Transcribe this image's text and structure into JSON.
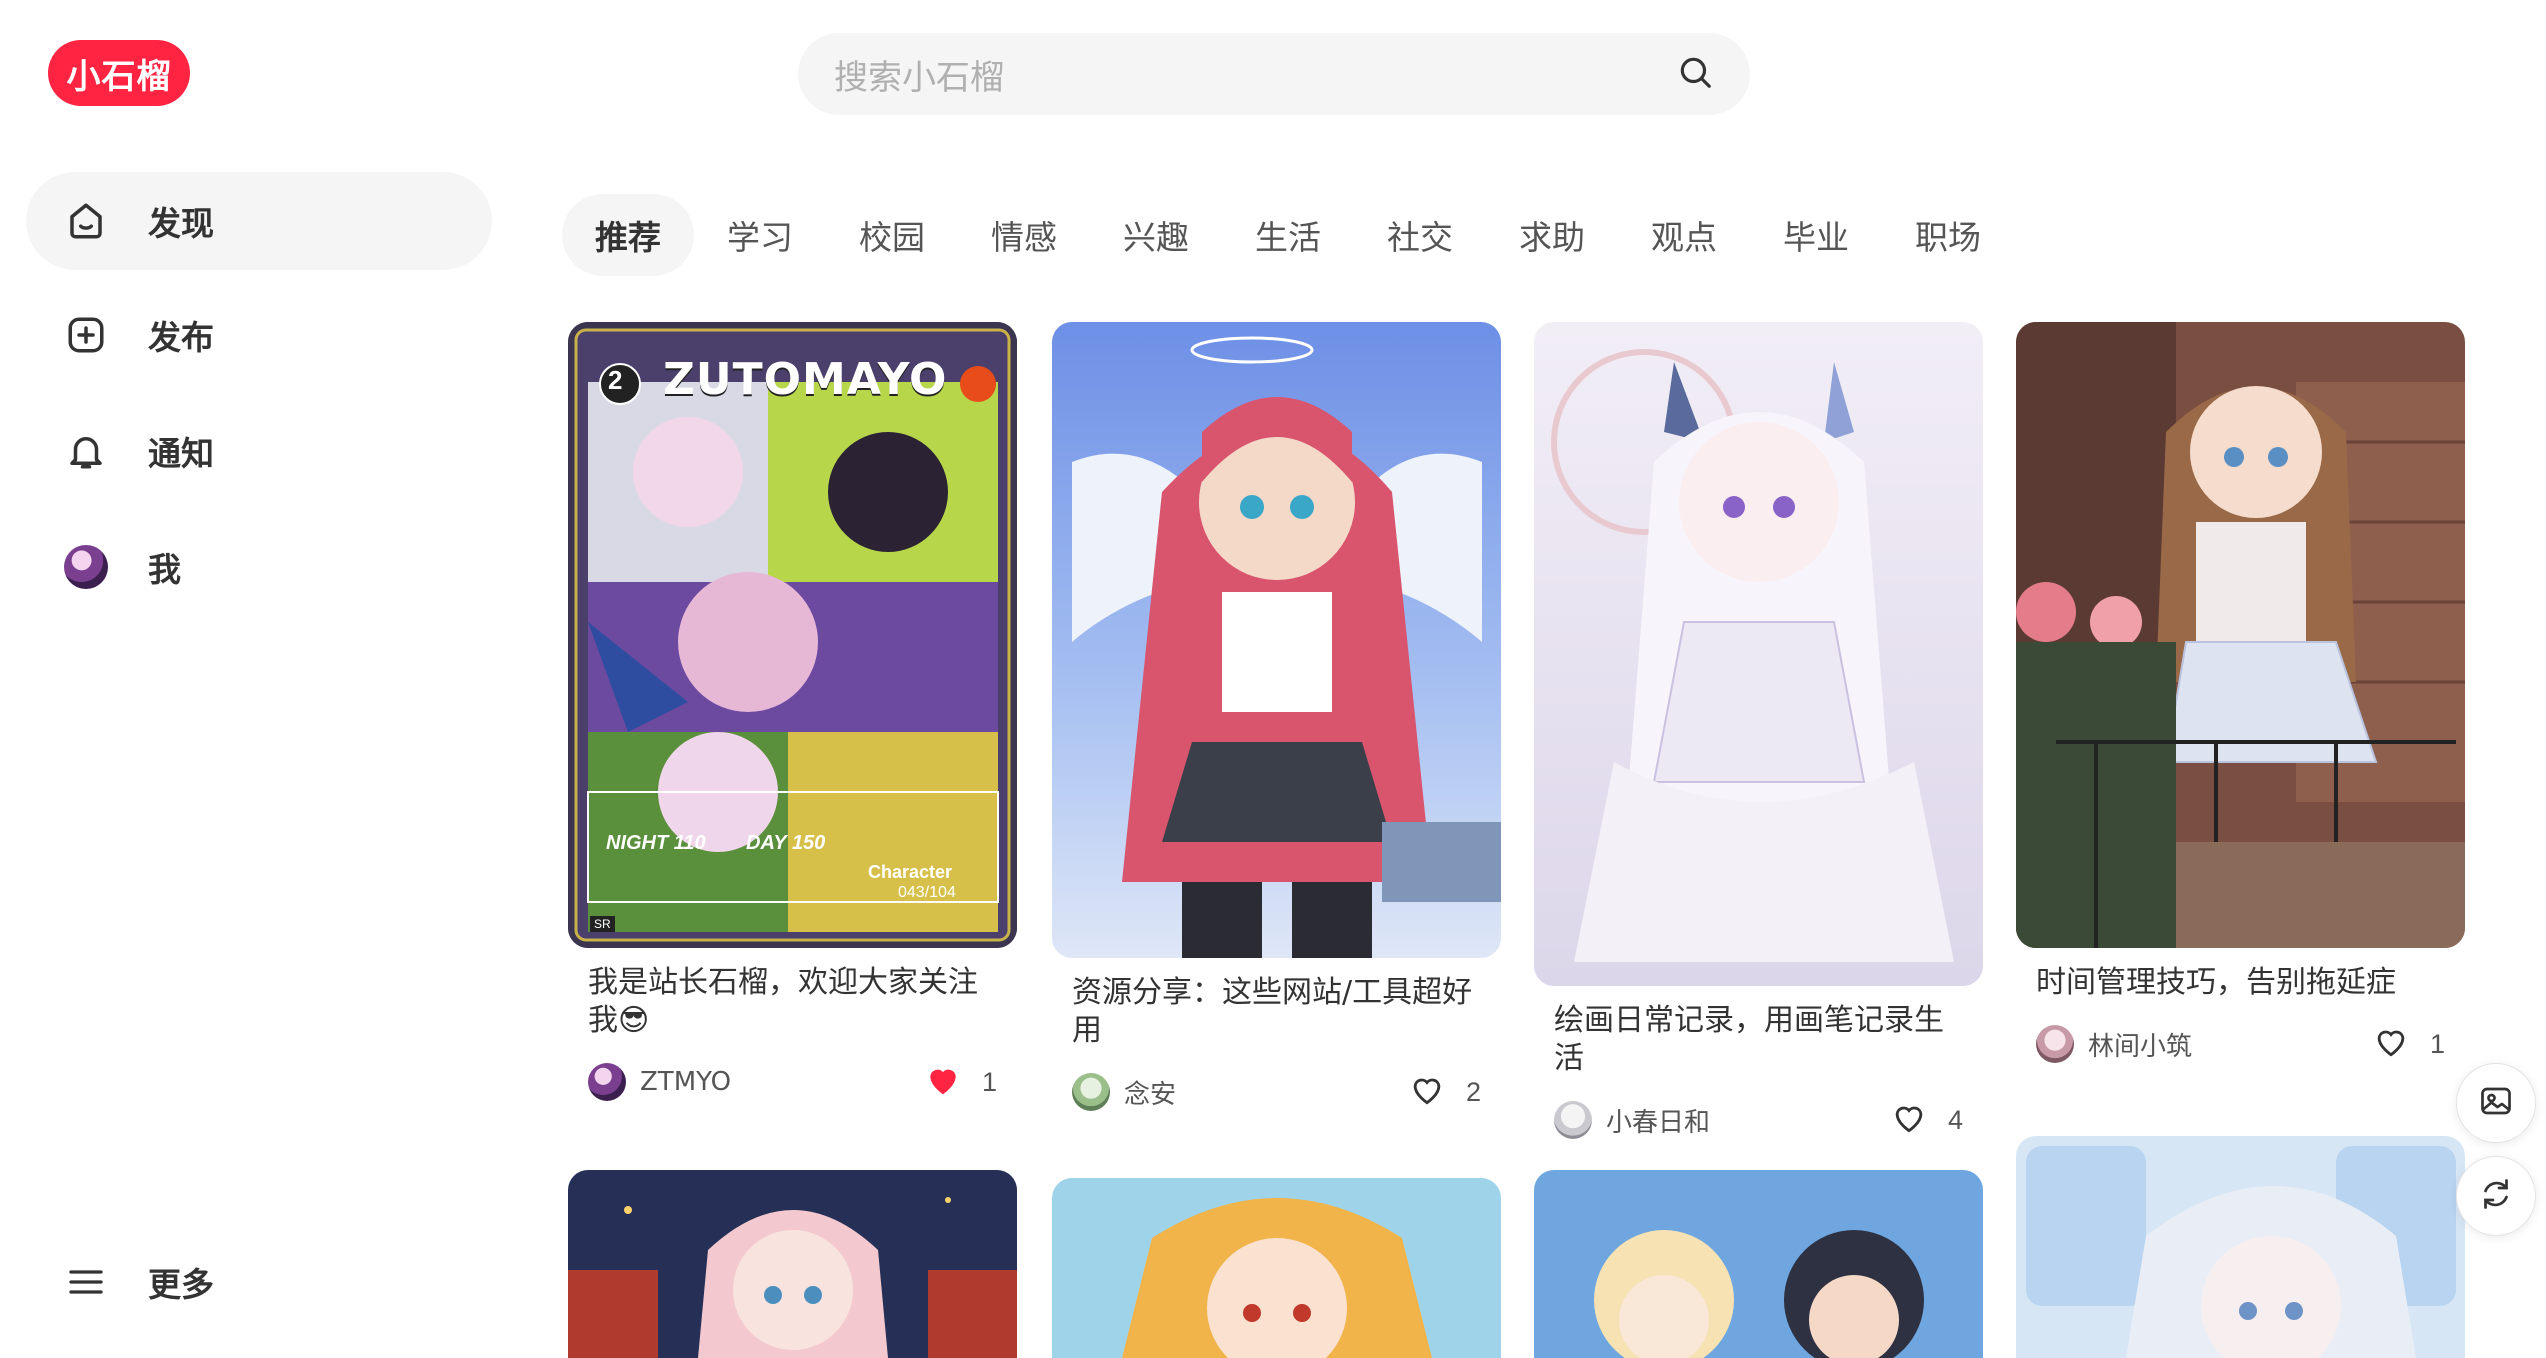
{
  "app": {
    "logo": "小石榴",
    "brand_color": "#ff2442"
  },
  "search": {
    "placeholder": "搜索小石榴",
    "icon": "search-icon"
  },
  "sidebar": {
    "items": [
      {
        "label": "发现",
        "icon": "home-icon",
        "active": true
      },
      {
        "label": "发布",
        "icon": "add-square-icon"
      },
      {
        "label": "通知",
        "icon": "bell-icon"
      },
      {
        "label": "我",
        "icon": "avatar"
      }
    ],
    "more": {
      "label": "更多",
      "icon": "menu-icon"
    }
  },
  "tabs": [
    {
      "label": "推荐",
      "active": true
    },
    {
      "label": "学习"
    },
    {
      "label": "校园"
    },
    {
      "label": "情感"
    },
    {
      "label": "兴趣"
    },
    {
      "label": "生活"
    },
    {
      "label": "社交"
    },
    {
      "label": "求助"
    },
    {
      "label": "观点"
    },
    {
      "label": "毕业"
    },
    {
      "label": "职场"
    }
  ],
  "feed": {
    "cards": [
      {
        "title": "我是站长石榴，欢迎大家关注我😎",
        "author": "ZTMYO",
        "likes": "1",
        "liked": true,
        "image_text": {
          "badge": "2",
          "brand": "ZUTOMAYO",
          "night": "NIGHT 110",
          "day": "DAY 150",
          "code": "043/104",
          "kind": "Character",
          "rarity": "SR"
        }
      },
      {
        "title": "资源分享：这些网站/工具超好用",
        "author": "念安",
        "likes": "2",
        "liked": false
      },
      {
        "title": "绘画日常记录，用画笔记录生活",
        "author": "小春日和",
        "likes": "4",
        "liked": false
      },
      {
        "title": "时间管理技巧，告别拖延症",
        "author": "林间小筑",
        "likes": "1",
        "liked": false
      }
    ]
  },
  "fabs": [
    {
      "icon": "image-icon"
    },
    {
      "icon": "refresh-icon"
    }
  ]
}
